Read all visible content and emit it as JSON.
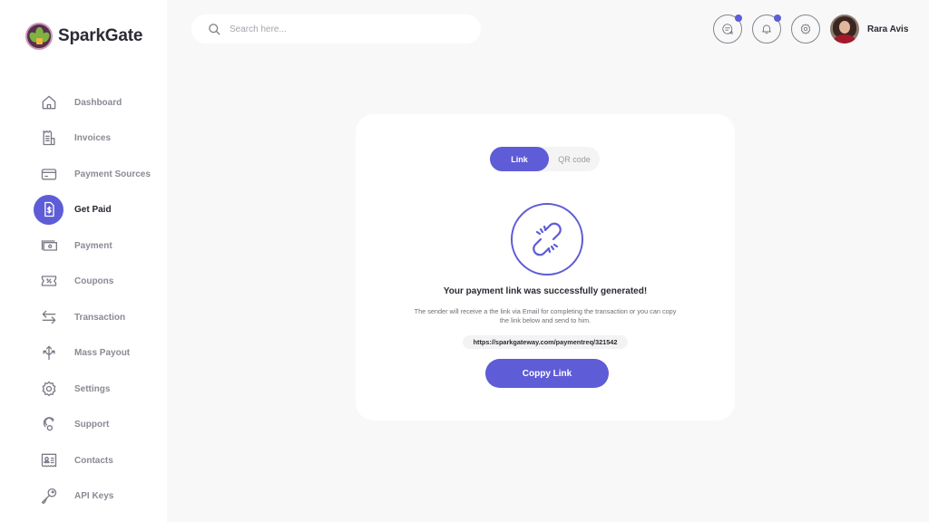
{
  "app": {
    "name": "SparkGate"
  },
  "colors": {
    "accent": "#5e5cd6",
    "background": "#f8f8f8",
    "sidebar": "#ffffff"
  },
  "search": {
    "placeholder": "Search here...",
    "value": ""
  },
  "header": {
    "icons": [
      {
        "name": "messages-icon",
        "has_badge": true
      },
      {
        "name": "bell-icon",
        "has_badge": true
      },
      {
        "name": "gear-icon",
        "has_badge": false
      }
    ],
    "user": {
      "name": "Rara Avis"
    }
  },
  "sidebar": {
    "items": [
      {
        "label": "Dashboard",
        "icon": "home-icon",
        "active": false
      },
      {
        "label": "Invoices",
        "icon": "invoice-icon",
        "active": false
      },
      {
        "label": "Payment Sources",
        "icon": "card-icon",
        "active": false
      },
      {
        "label": "Get Paid",
        "icon": "dollar-document-icon",
        "active": true
      },
      {
        "label": "Payment",
        "icon": "cash-icon",
        "active": false
      },
      {
        "label": "Coupons",
        "icon": "coupon-icon",
        "active": false
      },
      {
        "label": "Transaction",
        "icon": "transfer-arrows-icon",
        "active": false
      },
      {
        "label": "Mass Payout",
        "icon": "split-arrows-icon",
        "active": false
      },
      {
        "label": "Settings",
        "icon": "gear-icon",
        "active": false
      },
      {
        "label": "Support",
        "icon": "support-icon",
        "active": false
      },
      {
        "label": "Contacts",
        "icon": "contact-card-icon",
        "active": false
      },
      {
        "label": "API  Keys",
        "icon": "key-icon",
        "active": false
      }
    ]
  },
  "main": {
    "tabs": [
      {
        "label": "Link",
        "active": true
      },
      {
        "label": "QR code",
        "active": false
      }
    ],
    "status_icon": "broken-link-icon",
    "title": "Your payment link was successfully generated!",
    "description": "The sender will receive a the link via Email for completing the transaction or you can copy the link below and send to him.",
    "link_url": "https://sparkgateway.com/paymentreq/321542",
    "copy_button_label": "Coppy Link"
  }
}
